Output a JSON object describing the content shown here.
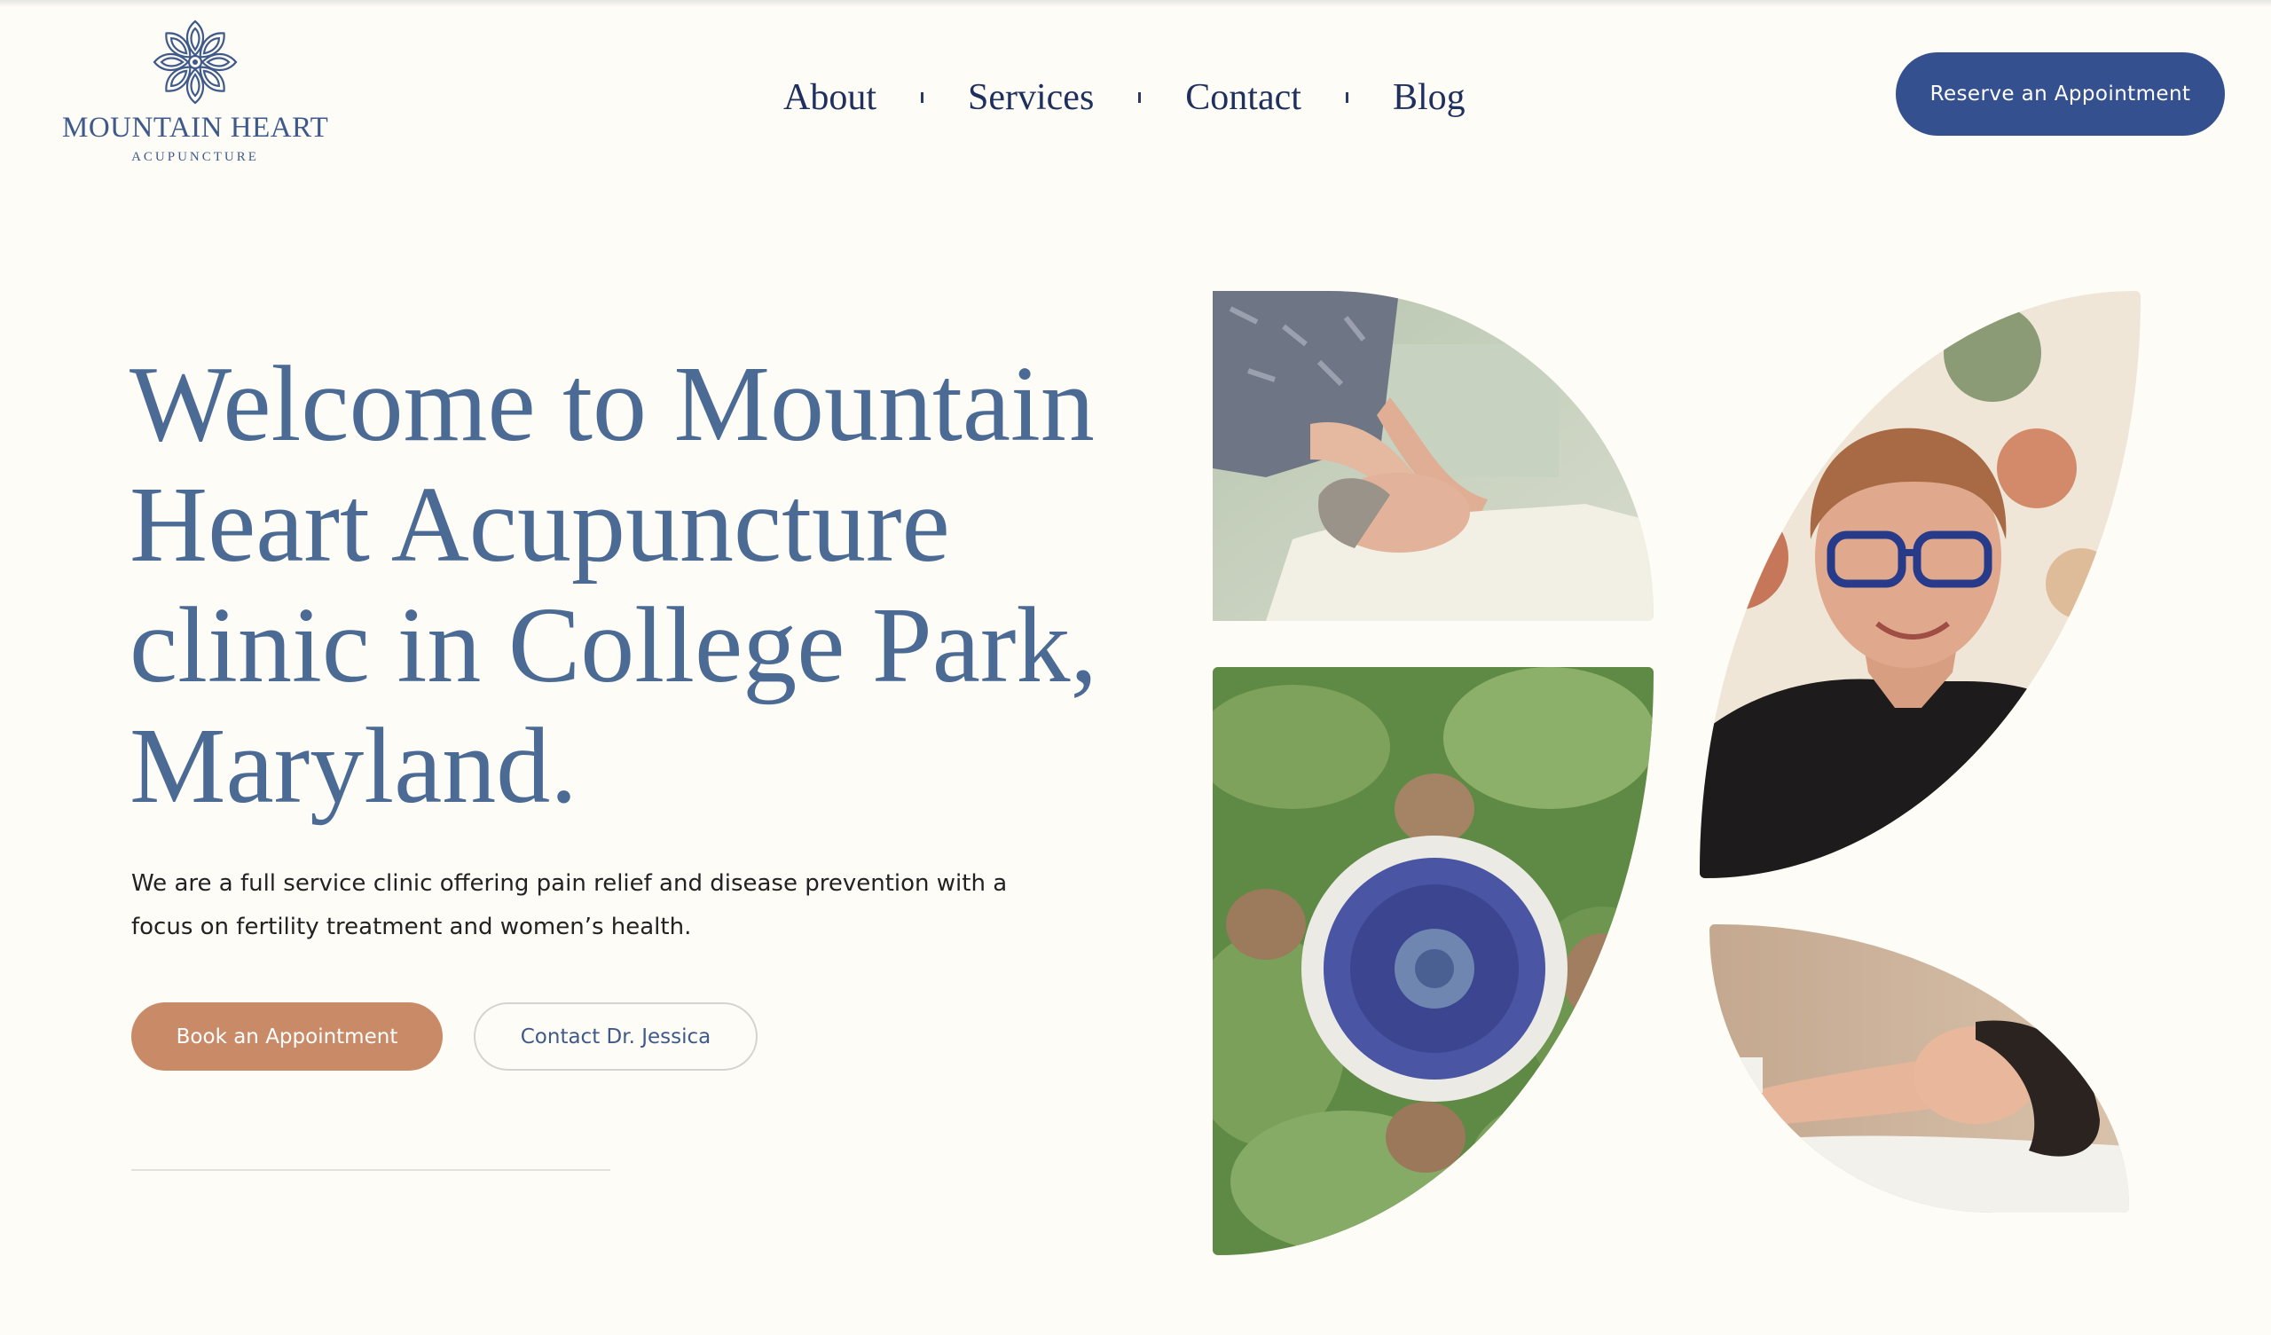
{
  "brand": {
    "name": "MOUNTAIN HEART",
    "tagline": "ACUPUNCTURE",
    "logo_icon": "lotus-mandala-icon"
  },
  "nav": {
    "items": [
      {
        "label": "About"
      },
      {
        "label": "Services"
      },
      {
        "label": "Contact"
      },
      {
        "label": "Blog"
      }
    ],
    "cta_label": "Reserve an Appointment"
  },
  "hero": {
    "title": "Welcome to Mountain Heart Acupuncture clinic in College Park, Maryland.",
    "description": "We are a full service clinic offering pain relief and disease prevention with a focus on fertility treatment and women’s health.",
    "primary_button": "Book an Appointment",
    "secondary_button": "Contact Dr. Jessica"
  },
  "gallery": {
    "images": [
      {
        "subject": "acupuncturist-treating-patient-photo"
      },
      {
        "subject": "dr-jessica-portrait-photo"
      },
      {
        "subject": "mushroom-pinecones-leaves-photo"
      },
      {
        "subject": "woman-relaxing-acupuncture-photo"
      }
    ]
  },
  "colors": {
    "background": "#fdfcf6",
    "brand_blue": "#34508e",
    "heading_blue": "#4b6a94",
    "nav_text": "#1f2f5e",
    "accent_terracotta": "#c98a68"
  }
}
